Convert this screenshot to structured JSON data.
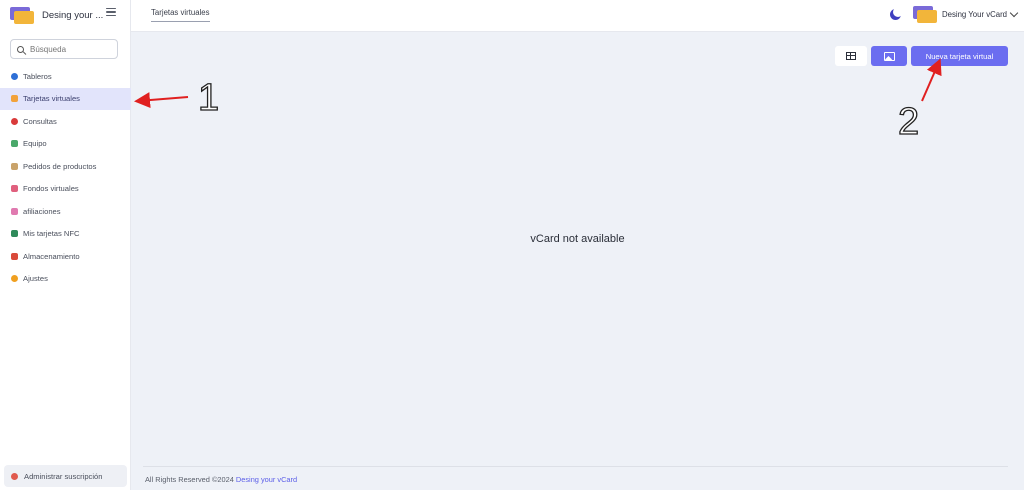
{
  "brand": {
    "name": "Desing your ..."
  },
  "search": {
    "placeholder": "Búsqueda"
  },
  "sidebar": {
    "items": [
      {
        "label": "Tableros",
        "icon": "globe-icon",
        "color": "#2e6fd6"
      },
      {
        "label": "Tarjetas virtuales",
        "icon": "card-icon",
        "color": "#f2a23a",
        "active": true
      },
      {
        "label": "Consultas",
        "icon": "info-icon",
        "color": "#d93a3a"
      },
      {
        "label": "Equipo",
        "icon": "team-icon",
        "color": "#4aa86a"
      },
      {
        "label": "Pedidos de productos",
        "icon": "order-icon",
        "color": "#c9a36a"
      },
      {
        "label": "Fondos virtuales",
        "icon": "gift-icon",
        "color": "#e0607e"
      },
      {
        "label": "afiliaciones",
        "icon": "affiliation-icon",
        "color": "#e07ab0"
      },
      {
        "label": "Mis tarjetas NFC",
        "icon": "nfc-icon",
        "color": "#2f8a5a"
      },
      {
        "label": "Almacenamiento",
        "icon": "storage-icon",
        "color": "#d94a3a"
      },
      {
        "label": "Ajustes",
        "icon": "gear-icon",
        "color": "#f0a020"
      }
    ],
    "subscription_label": "Administrar suscripción"
  },
  "header": {
    "tab_label": "Tarjetas virtuales",
    "user_name": "Desing Your vCard"
  },
  "main": {
    "new_button_label": "Nueva tarjeta virtual",
    "empty_message": "vCard not available"
  },
  "footer": {
    "text": "All Rights Reserved ©2024",
    "link": "Desing your vCard"
  },
  "annotations": {
    "label1": "1",
    "label2": "2"
  },
  "colors": {
    "accent": "#6b6df0",
    "arrow": "#e02020"
  }
}
